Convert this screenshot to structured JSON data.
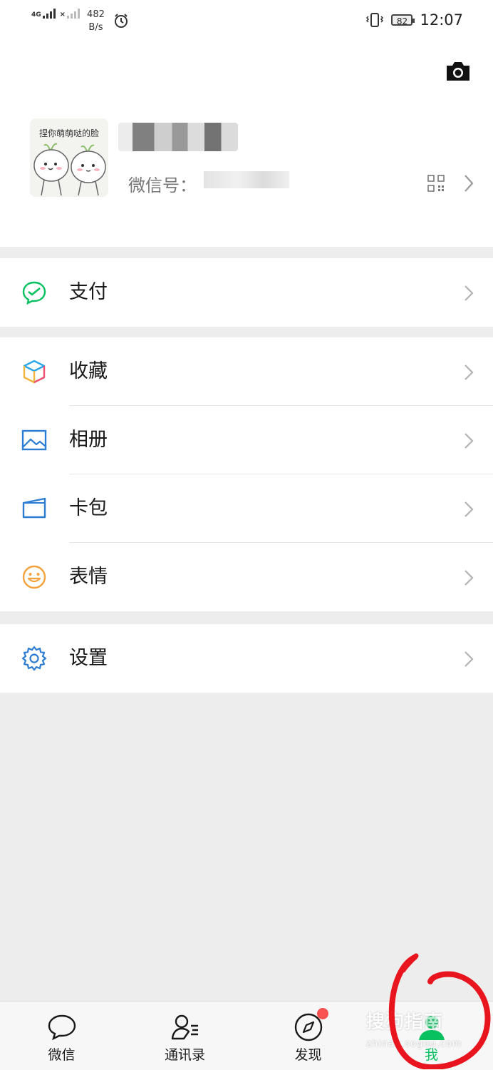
{
  "status_bar": {
    "network1": "4G",
    "net_speed_value": "482",
    "net_speed_unit": "B/s",
    "battery": "82",
    "time": "12:07"
  },
  "profile": {
    "avatar_caption": "捏你萌萌哒的脸",
    "wxid_label": "微信号：",
    "icons": [
      "camera-icon",
      "qr-code-icon",
      "chevron-right-icon"
    ]
  },
  "menu": {
    "pay": "支付",
    "favorites": "收藏",
    "album": "相册",
    "cards": "卡包",
    "stickers": "表情",
    "settings": "设置"
  },
  "tabbar": {
    "chats": "微信",
    "contacts": "通讯录",
    "discover": "发现",
    "me": "我"
  },
  "watermark": {
    "text": "搜狗指南",
    "url": "zhinan.sogou.com"
  },
  "colors": {
    "accent": "#07c160",
    "badge": "#fa5151",
    "annotation": "#e8141e"
  }
}
